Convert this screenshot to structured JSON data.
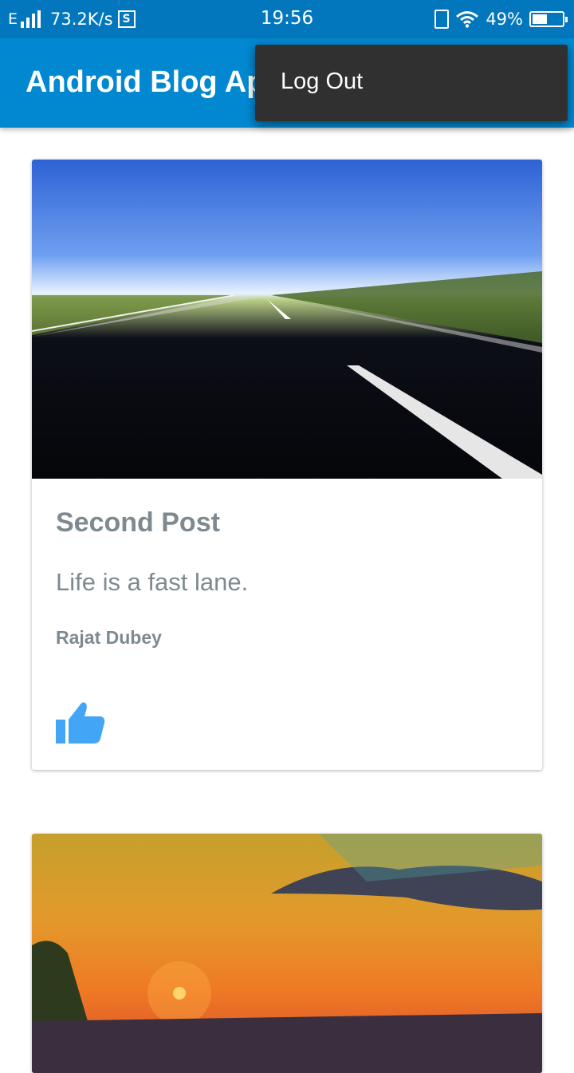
{
  "status_bar": {
    "network_type": "E",
    "speed": "73.2K/s",
    "s_icon": "S",
    "time": "19:56",
    "battery_percent": "49%",
    "battery_level": 0.49
  },
  "app_bar": {
    "title": "Android Blog App"
  },
  "menu": {
    "items": [
      {
        "label": "Log Out"
      }
    ]
  },
  "posts": [
    {
      "image": "road-photo",
      "title": "Second Post",
      "body": "Life is a fast lane.",
      "author": "Rajat Dubey",
      "like_icon": "thumbs-up-icon",
      "like_color": "#42a5f5"
    },
    {
      "image": "sunset-photo"
    }
  ],
  "colors": {
    "status_bar": "#0277bd",
    "app_bar": "#0288d1",
    "menu_bg": "#303030",
    "post_text": "#7e8a8f"
  }
}
